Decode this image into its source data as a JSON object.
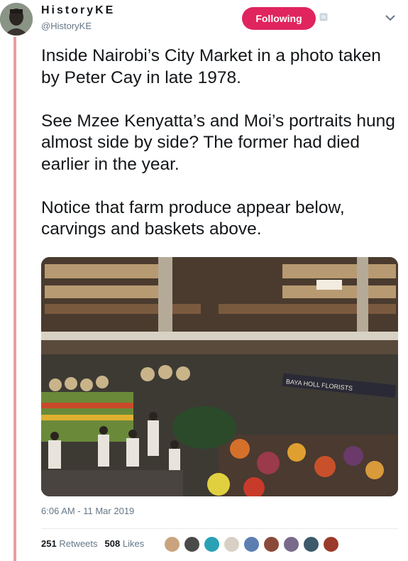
{
  "author": {
    "display_name": "HistoryKE",
    "handle": "@HistoryKE"
  },
  "follow_button": {
    "label": "Following",
    "color": "#e0245e"
  },
  "tweet": {
    "paragraphs": [
      "Inside Nairobi’s City Market in a photo taken by Peter Cay in late 1978.",
      "See Mzee Kenyatta’s and Moi’s portraits hung almost side by side? The former had died earlier in the year.",
      "Notice that farm produce appear below, carvings and baskets above."
    ],
    "timestamp": "6:06 AM - 11 Mar 2019"
  },
  "photo": {
    "description_icon": "market-photo",
    "sign_text": "BAYA HOLL FLORISTS"
  },
  "stats": {
    "retweets_count": "251",
    "retweets_label": "Retweets",
    "likes_count": "508",
    "likes_label": "Likes"
  },
  "likers": [
    {
      "color": "#c9a27e"
    },
    {
      "color": "#4a4a4a"
    },
    {
      "color": "#2aa1b5"
    },
    {
      "color": "#d8d0c5"
    },
    {
      "color": "#5b7fb0"
    },
    {
      "color": "#8a4a3a"
    },
    {
      "color": "#7a6a8a"
    },
    {
      "color": "#3c5a6a"
    },
    {
      "color": "#9a3a2a"
    }
  ],
  "colors": {
    "thread_line": "#e9a0a0",
    "secondary_text": "#657786"
  }
}
